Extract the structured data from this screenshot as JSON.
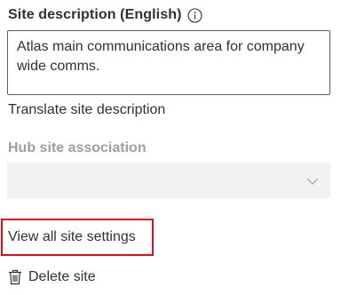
{
  "site_description": {
    "label": "Site description (English)",
    "info_icon": "info-icon",
    "value": "Atlas main communications area for company wide comms."
  },
  "translate": {
    "label": "Translate site description"
  },
  "hub_site": {
    "label": "Hub site association",
    "selected": "",
    "disabled": true,
    "chevron_icon": "chevron-down-icon"
  },
  "view_all": {
    "label": "View all site settings",
    "highlight_color": "#e00b1c"
  },
  "delete_site": {
    "label": "Delete site",
    "icon": "trash-icon"
  }
}
